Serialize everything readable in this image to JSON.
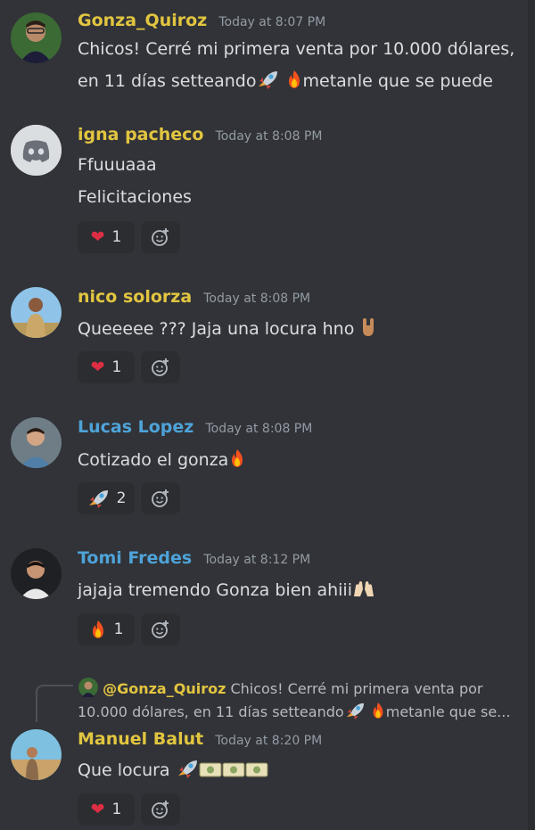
{
  "colors": {
    "background": "#313338",
    "yellow_user": "#e2c540",
    "blue_user": "#4ea3d8",
    "timestamp": "#949ba4",
    "text": "#dbdee1",
    "reaction_bg": "#2b2d31"
  },
  "messages": [
    {
      "username": "Gonza_Quiroz",
      "timestamp": "Today at 8:07 PM",
      "lines": [
        "Chicos! Cerré mi primera venta por 10.000 dólares,",
        "en 11 días setteando",
        "metanle que se puede"
      ]
    },
    {
      "username": "igna pacheco",
      "timestamp": "Today at 8:08 PM",
      "lines": [
        "Ffuuuaaa",
        "Felicitaciones"
      ],
      "reaction": {
        "emoji": "heart",
        "count": "1"
      }
    },
    {
      "username": "nico solorza",
      "timestamp": "Today at 8:08 PM",
      "lines": [
        "Queeeee ??? Jaja una locura hno"
      ],
      "reaction": {
        "emoji": "heart",
        "count": "1"
      }
    },
    {
      "username": "Lucas Lopez",
      "timestamp": "Today at 8:08 PM",
      "lines": [
        "Cotizado el gonza"
      ],
      "reaction": {
        "emoji": "rocket",
        "count": "2"
      }
    },
    {
      "username": "Tomi Fredes",
      "timestamp": "Today at 8:12 PM",
      "lines": [
        "jajaja tremendo Gonza bien ahiii"
      ],
      "reaction": {
        "emoji": "fire",
        "count": "1"
      }
    },
    {
      "reply": {
        "mention": "@Gonza_Quiroz",
        "line1": "Chicos! Cerré mi primera venta por",
        "line2a": "10.000 dólares, en 11 días setteando",
        "line2b": "metanle que se..."
      },
      "username": "Manuel Balut",
      "timestamp": "Today at 8:20 PM",
      "lines": [
        "Que locura"
      ],
      "reaction": {
        "emoji": "heart",
        "count": "1"
      }
    }
  ]
}
